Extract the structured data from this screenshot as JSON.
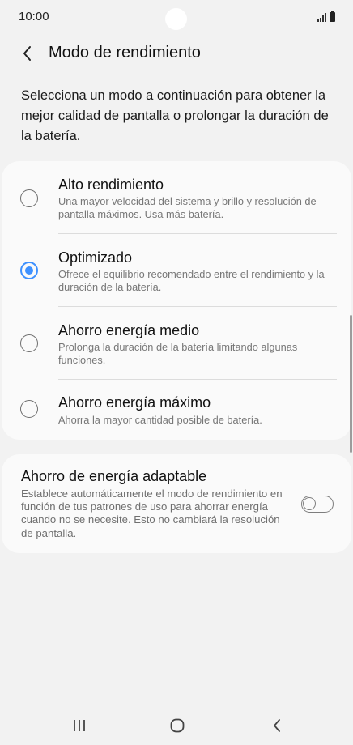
{
  "status_bar": {
    "time": "10:00",
    "signal_icon": "signal-bars-icon",
    "battery_icon": "battery-icon"
  },
  "header": {
    "back_icon": "chevron-left-icon",
    "title": "Modo de rendimiento"
  },
  "description": "Selecciona un modo a continuación para obtener la mejor calidad de pantalla o prolongar la duración de la batería.",
  "modes": {
    "selected_index": 1,
    "accent_color": "#3e91ff",
    "items": [
      {
        "title": "Alto rendimiento",
        "description": "Una mayor velocidad del sistema y brillo y resolución de pantalla máximos. Usa más batería."
      },
      {
        "title": "Optimizado",
        "description": "Ofrece el equilibrio recomendado entre el rendimiento y la duración de la batería."
      },
      {
        "title": "Ahorro energía medio",
        "description": "Prolonga la duración de la batería limitando algunas funciones."
      },
      {
        "title": "Ahorro energía máximo",
        "description": "Ahorra la mayor cantidad posible de batería."
      }
    ]
  },
  "adaptive": {
    "title": "Ahorro de energía adaptable",
    "description": "Establece automáticamente el modo de rendimiento en función de tus patrones de uso para ahorrar energía cuando no se necesite. Esto no cambiará la resolución de pantalla.",
    "enabled": false
  },
  "nav_bar": {
    "recents_icon": "recents-icon",
    "home_icon": "home-icon",
    "back_icon": "back-chevron-icon"
  }
}
